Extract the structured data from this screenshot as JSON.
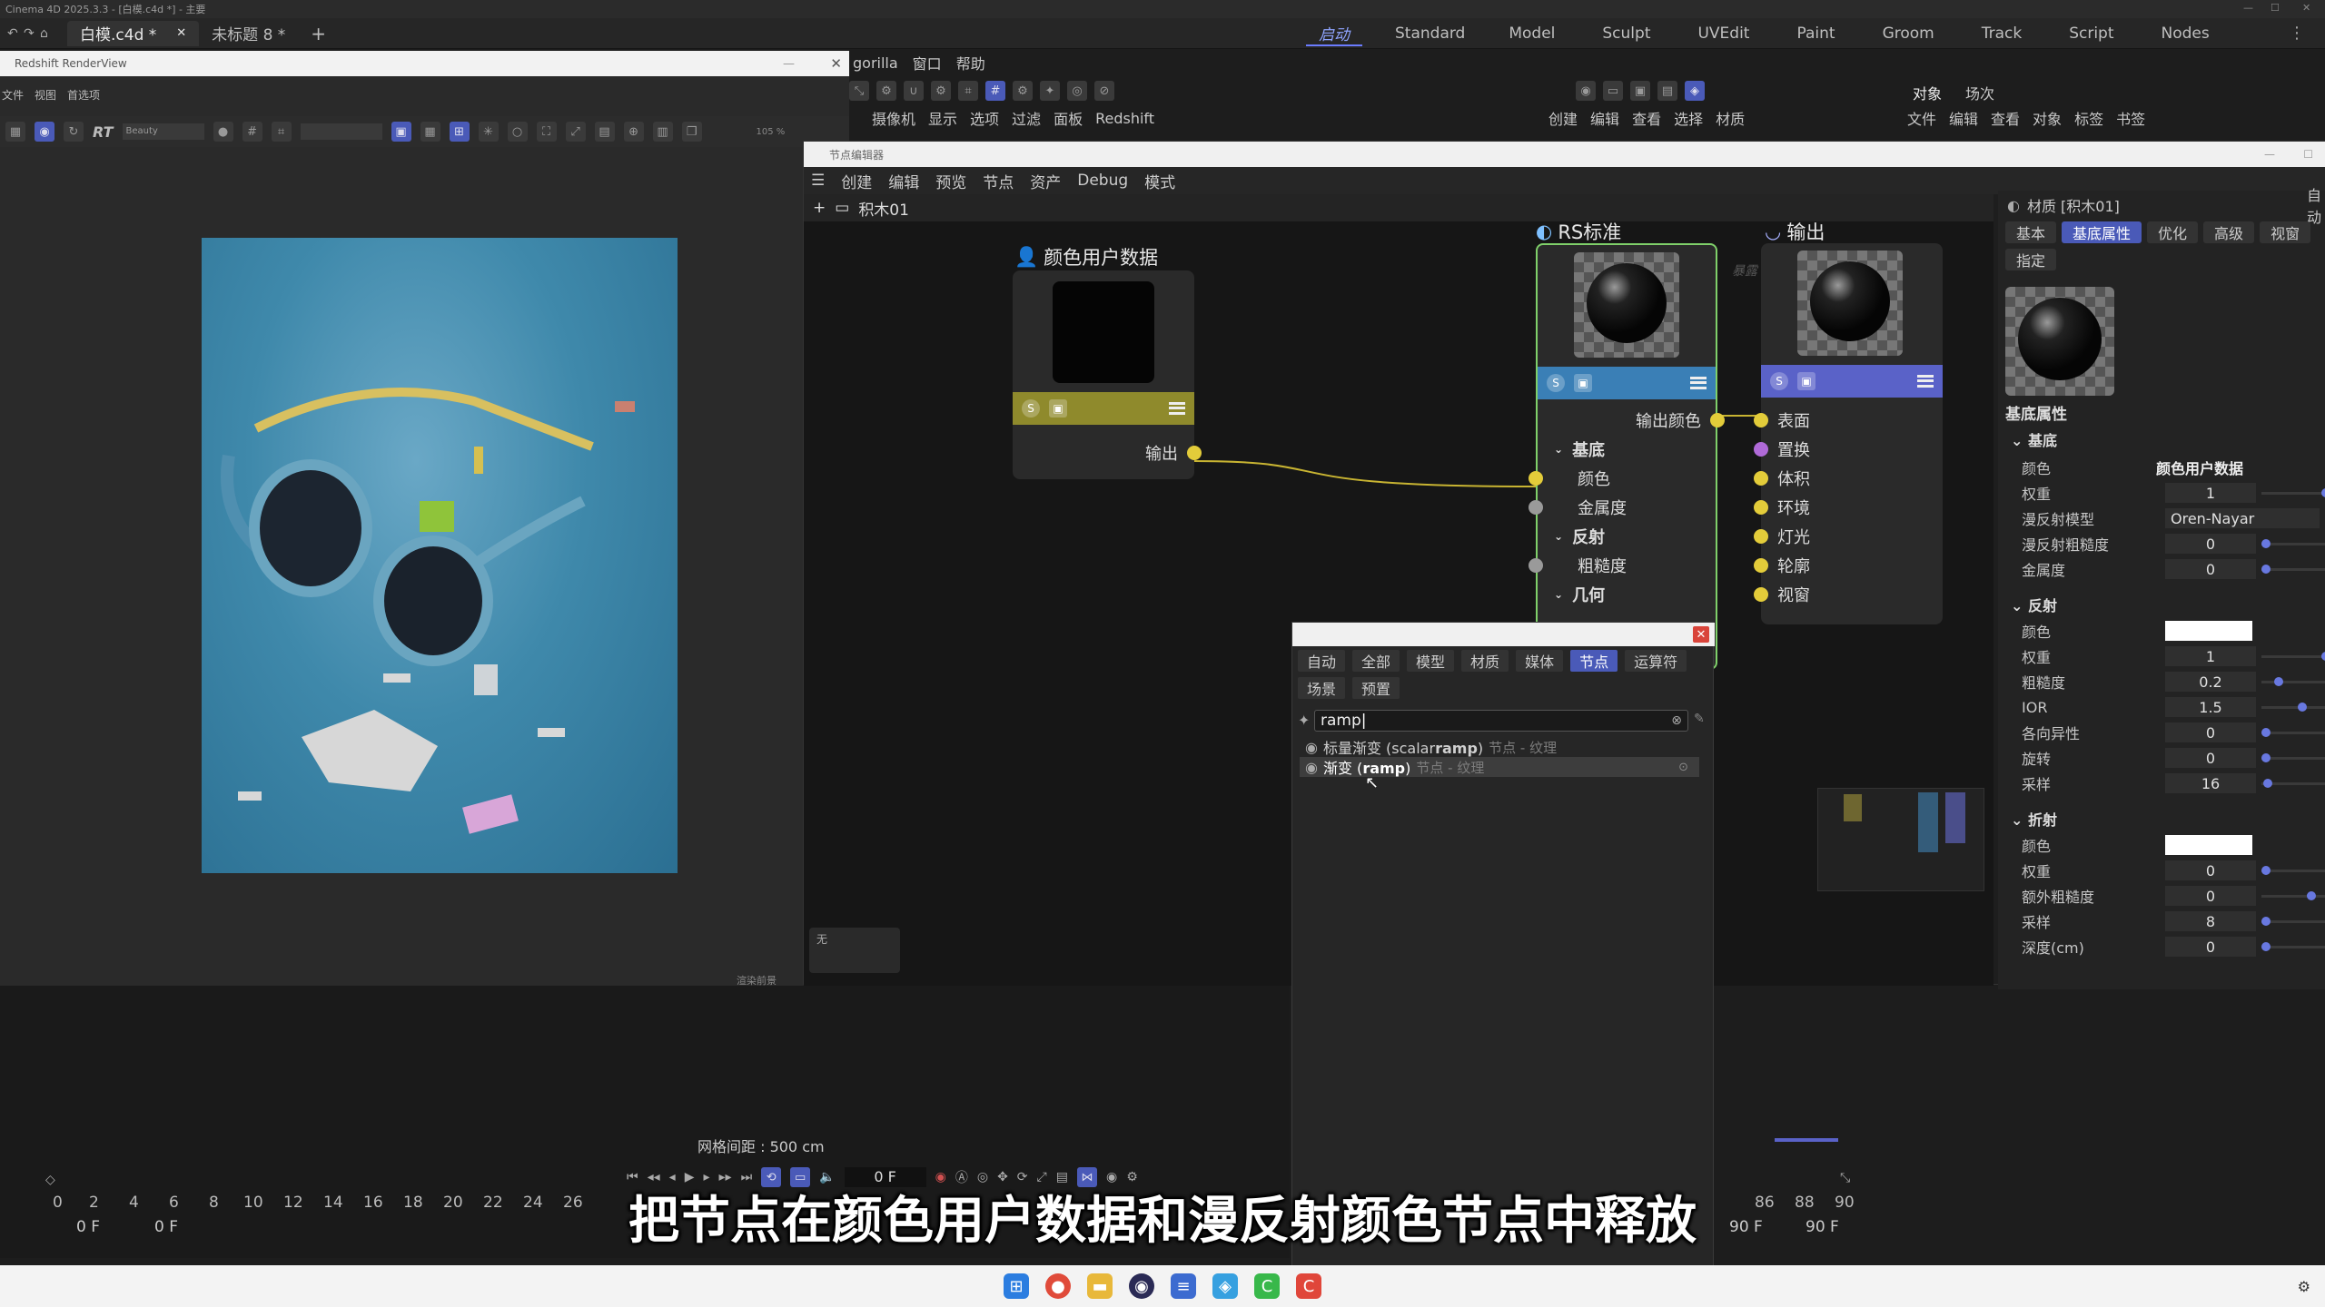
{
  "app": {
    "title": "Cinema 4D 2025.3.3 - [白模.c4d *] - 主要",
    "doc_tabs": [
      "白模.c4d *",
      "未标题 8 *"
    ],
    "add_tab": "+",
    "layout_tabs": [
      "启动",
      "Standard",
      "Model",
      "Sculpt",
      "UVEdit",
      "Paint",
      "Groom",
      "Track",
      "Script",
      "Nodes"
    ],
    "active_layout": "启动"
  },
  "renderview": {
    "title": "Redshift RenderView",
    "menu": [
      "文件",
      "视图",
      "首选项"
    ],
    "rt_label": "RT",
    "beauty": "Beauty",
    "zoom": "105 %",
    "status": "渲染前景"
  },
  "main_menu": [
    "gorilla",
    "窗口",
    "帮助"
  ],
  "toolbar2": [
    "摄像机",
    "显示",
    "选项",
    "过滤",
    "面板",
    "Redshift"
  ],
  "object_manager": {
    "tabs": [
      "对象",
      "场次"
    ],
    "menu": [
      "文件",
      "编辑",
      "查看",
      "对象",
      "标签",
      "书签"
    ],
    "top_menu": [
      "创建",
      "编辑",
      "查看",
      "选择",
      "材质"
    ]
  },
  "node_editor": {
    "title": "节点编辑器",
    "menu": [
      "创建",
      "编辑",
      "预览",
      "节点",
      "资产",
      "Debug",
      "模式"
    ],
    "breadcrumb": "积木01",
    "canvas_hint": "暴露",
    "empty_label": "无",
    "nodes": {
      "color_user_data": {
        "title": "颜色用户数据",
        "output": "输出",
        "bar_color": "#8f8a2c"
      },
      "rs_standard": {
        "title": "RS标准",
        "output": "输出颜色",
        "groups": [
          {
            "label": "基底",
            "ports": [
              "颜色",
              "金属度"
            ]
          },
          {
            "label": "反射",
            "ports": [
              "粗糙度"
            ]
          },
          {
            "label": "几何",
            "ports": []
          }
        ],
        "bar_color": "#3a7fb6"
      },
      "output": {
        "title": "输出",
        "ports": [
          "表面",
          "置换",
          "体积",
          "环境",
          "灯光",
          "轮廓",
          "视窗"
        ],
        "bar_color": "#5a62c8"
      }
    }
  },
  "search_popup": {
    "tabs_row1": [
      "自动",
      "全部",
      "模型",
      "材质",
      "媒体",
      "节点",
      "运算符"
    ],
    "tabs_row2": [
      "场景",
      "预置"
    ],
    "active_tab": "节点",
    "query": "ramp",
    "results": [
      {
        "name_pre": "标量渐变 (scalar",
        "name_match": "ramp",
        "name_post": ")",
        "meta": "节点 - 纹理"
      },
      {
        "name_pre": "渐变 (",
        "name_match": "ramp",
        "name_post": ")",
        "meta": "节点 - 纹理"
      }
    ]
  },
  "attributes": {
    "title": "材质 [积木01]",
    "tab_extra": "自动",
    "tabs": [
      "基本",
      "基底属性",
      "优化",
      "高级",
      "视窗"
    ],
    "tab_assign": "指定",
    "active_tab": "基底属性",
    "section_title": "基底属性",
    "base": {
      "label": "基底",
      "rows": [
        {
          "label": "颜色",
          "value": "颜色用户数据"
        },
        {
          "label": "权重",
          "value": "1"
        },
        {
          "label": "漫反射模型",
          "value": "Oren-Nayar"
        },
        {
          "label": "漫反射粗糙度",
          "value": "0"
        },
        {
          "label": "金属度",
          "value": "0"
        }
      ]
    },
    "reflection": {
      "label": "反射",
      "rows": [
        {
          "label": "颜色",
          "value": ""
        },
        {
          "label": "权重",
          "value": "1"
        },
        {
          "label": "粗糙度",
          "value": "0.2"
        },
        {
          "label": "IOR",
          "value": "1.5"
        },
        {
          "label": "各向异性",
          "value": "0"
        },
        {
          "label": "旋转",
          "value": "0"
        },
        {
          "label": "采样",
          "value": "16"
        }
      ]
    },
    "refraction": {
      "label": "折射",
      "rows": [
        {
          "label": "颜色",
          "value": ""
        },
        {
          "label": "权重",
          "value": "0"
        },
        {
          "label": "额外粗糙度",
          "value": "0"
        },
        {
          "label": "采样",
          "value": "8"
        },
        {
          "label": "深度(cm)",
          "value": "0"
        }
      ]
    }
  },
  "timeline": {
    "grid_spacing": "网格间距 : 500 cm",
    "current_frame": "0 F",
    "ticks": [
      "0",
      "2",
      "4",
      "6",
      "8",
      "10",
      "12",
      "14",
      "16",
      "18",
      "20",
      "22",
      "24",
      "26"
    ],
    "ticks_right": [
      "86",
      "88",
      "90"
    ],
    "start": "0 F",
    "start2": "0 F",
    "end": "90 F",
    "end2": "90 F"
  },
  "subtitle": "把节点在颜色用户数据和漫反射颜色节点中释放",
  "taskbar": {
    "icons": [
      "windows-icon",
      "chrome-icon",
      "folder-icon",
      "c4d-icon",
      "notes-icon",
      "browser-icon",
      "app-green-icon",
      "app-red-icon"
    ]
  }
}
